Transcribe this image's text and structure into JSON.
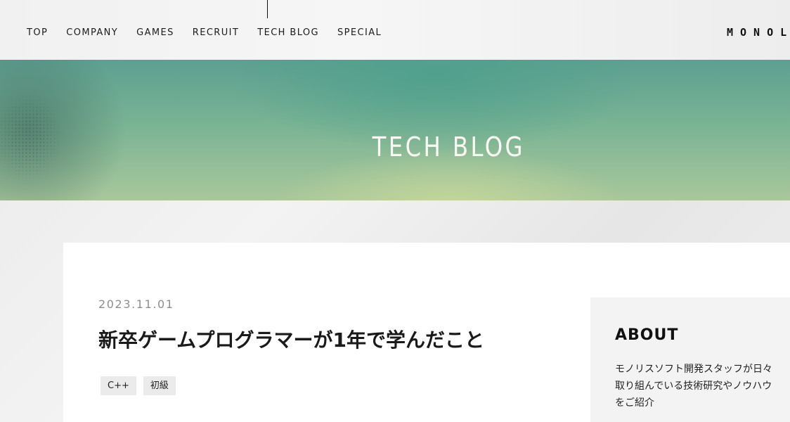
{
  "nav": {
    "items": [
      "TOP",
      "COMPANY",
      "GAMES",
      "RECRUIT",
      "TECH BLOG",
      "SPECIAL"
    ]
  },
  "logo": {
    "text": "MONOL"
  },
  "hero": {
    "title": "TECH BLOG"
  },
  "post": {
    "date": "2023.11.01",
    "title": "新卒ゲームプログラマーが1年で学んだこと",
    "tags": [
      "C++",
      "初級"
    ]
  },
  "sidebar": {
    "about_title": "ABOUT",
    "about_text": "モノリスソフト開発スタッフが日々取り組んでいる技術研究やノウハウをご紹介"
  },
  "colors": {
    "hero_teal": "#5d9f91",
    "hero_green": "#a9c79b",
    "date_gray": "#8e8e8e",
    "tag_bg": "#ebebeb",
    "sidebar_bg": "#f3f3f3"
  }
}
